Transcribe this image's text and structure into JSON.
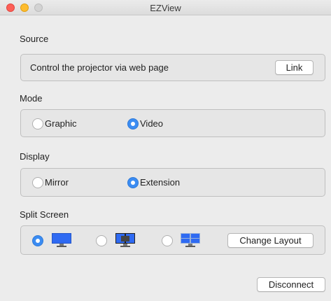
{
  "window": {
    "title": "EZView"
  },
  "source": {
    "label": "Source",
    "description": "Control the projector via web page",
    "link_button": "Link"
  },
  "mode": {
    "label": "Mode",
    "options": [
      "Graphic",
      "Video"
    ],
    "selected": "Video"
  },
  "display": {
    "label": "Display",
    "options": [
      "Mirror",
      "Extension"
    ],
    "selected": "Extension"
  },
  "split_screen": {
    "label": "Split Screen",
    "layouts": [
      "single-screen-icon",
      "split-screen-icon",
      "quad-screen-icon"
    ],
    "selected_layout": 0,
    "change_layout_button": "Change Layout"
  },
  "footer": {
    "disconnect_button": "Disconnect"
  },
  "colors": {
    "accent": "#3b8cf2",
    "panel": "#e6e6e6",
    "window": "#ececec"
  }
}
